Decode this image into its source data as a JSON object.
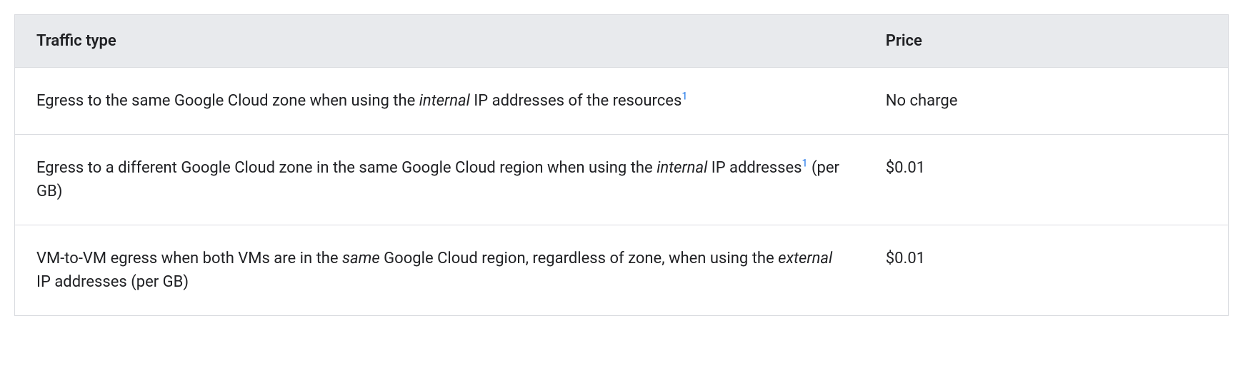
{
  "table": {
    "headers": {
      "traffic_type": "Traffic type",
      "price": "Price"
    },
    "rows": [
      {
        "traffic_pre": "Egress to the same Google Cloud zone when using the ",
        "italic1": "internal",
        "traffic_mid": " IP addresses of the resources",
        "footnote1": "1",
        "traffic_post": "",
        "price": "No charge"
      },
      {
        "traffic_pre": "Egress to a different Google Cloud zone in the same Google Cloud region when using the ",
        "italic1": "internal",
        "traffic_mid": " IP addresses",
        "footnote1": "1",
        "traffic_post": " (per GB)",
        "price": "$0.01"
      },
      {
        "traffic_pre": "VM-to-VM egress when both VMs are in the ",
        "italic1": "same",
        "traffic_mid": " Google Cloud region, regardless of zone, when using the ",
        "italic2": "external",
        "traffic_post": " IP addresses (per GB)",
        "price": "$0.01"
      }
    ]
  }
}
